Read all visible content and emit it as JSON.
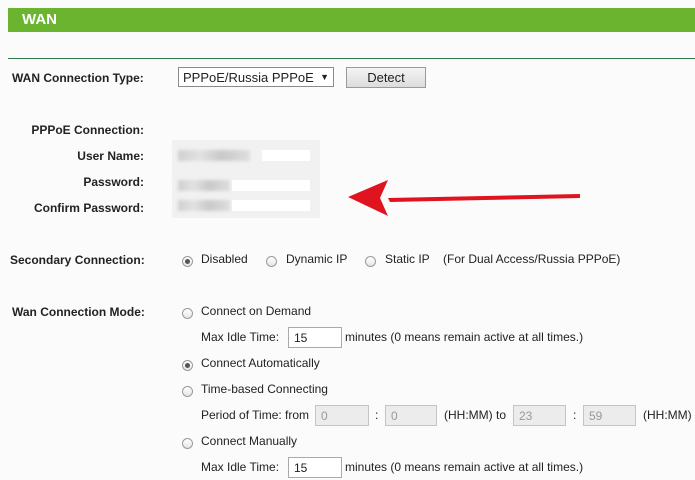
{
  "header": {
    "title": "WAN"
  },
  "wan_type": {
    "label": "WAN Connection Type:",
    "value": "PPPoE/Russia PPPoE",
    "detect": "Detect"
  },
  "pppoe": {
    "heading": "PPPoE Connection:",
    "user": "User Name:",
    "password": "Password:",
    "confirm": "Confirm Password:"
  },
  "secondary": {
    "label": "Secondary Connection:",
    "opt_disabled": "Disabled",
    "opt_dynamic": "Dynamic IP",
    "opt_static": "Static IP",
    "note": "(For Dual Access/Russia PPPoE)",
    "selected": "Disabled"
  },
  "mode": {
    "label": "Wan Connection Mode:",
    "on_demand": "Connect on Demand",
    "max_idle_label": "Max Idle Time:",
    "max_idle_value": "15",
    "max_idle_note": "minutes (0 means remain active at all times.)",
    "auto": "Connect Automatically",
    "time_based": "Time-based Connecting",
    "period_label": "Period of Time: from",
    "from_h": "0",
    "from_m": "0",
    "hhmm_to": "(HH:MM) to",
    "to_h": "23",
    "to_m": "59",
    "hhmm": "(HH:MM)",
    "colon": ":",
    "manual": "Connect Manually",
    "max_idle_value2": "15",
    "selected": "Connect Automatically"
  },
  "colors": {
    "header": "#6ab42f",
    "arrow": "#e0141e"
  }
}
